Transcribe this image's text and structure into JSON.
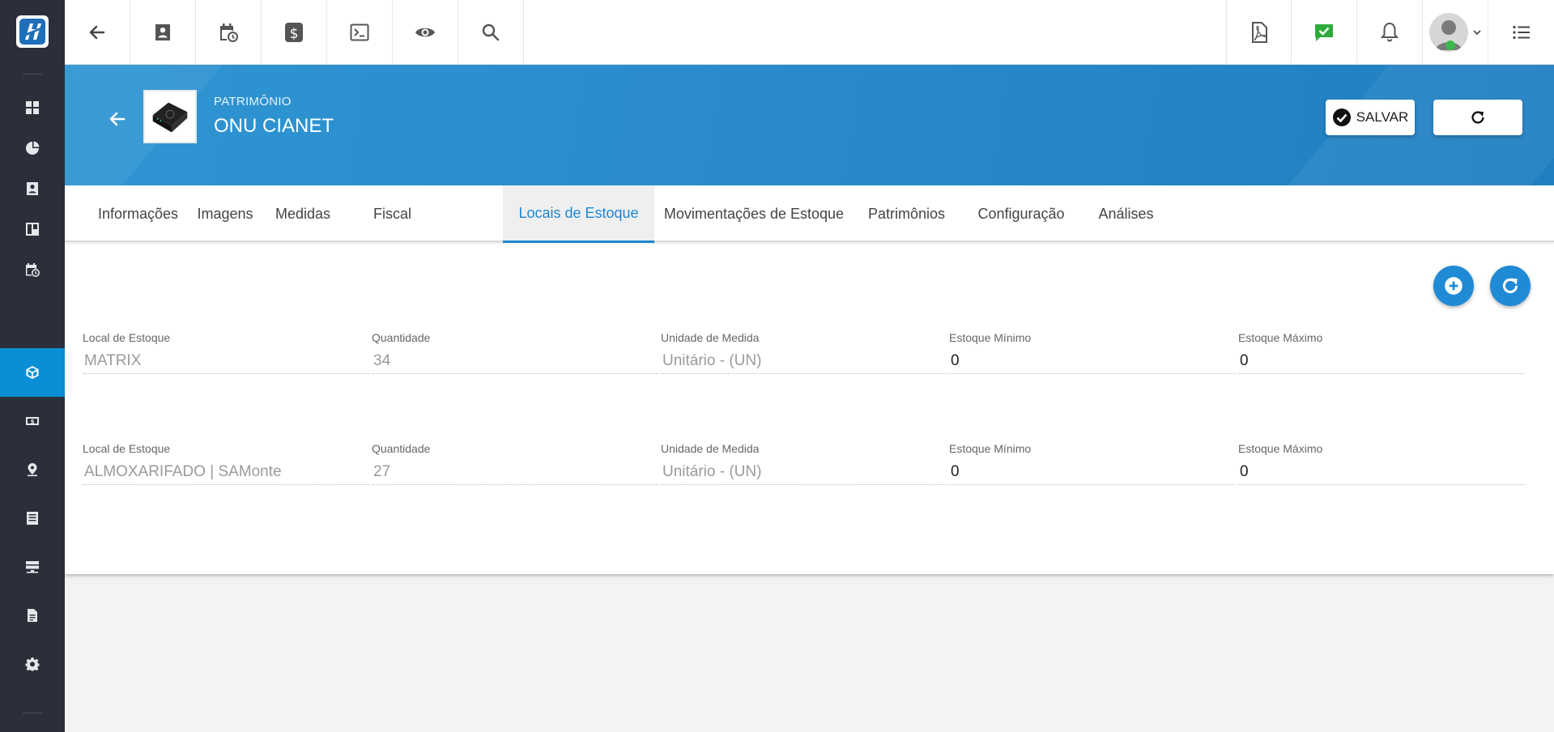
{
  "header": {
    "breadcrumb": "PATRIMÔNIO",
    "title": "ONU CIANET",
    "save_label": "SALVAR"
  },
  "tabs": [
    {
      "label": "Informações"
    },
    {
      "label": "Imagens"
    },
    {
      "label": "Medidas"
    },
    {
      "label": "Fiscal"
    },
    {
      "label": "Locais de Estoque",
      "active": true
    },
    {
      "label": "Movimentações de Estoque"
    },
    {
      "label": "Patrimônios"
    },
    {
      "label": "Configuração"
    },
    {
      "label": "Análises"
    }
  ],
  "stock_locations": {
    "labels": {
      "location": "Local de Estoque",
      "quantity": "Quantidade",
      "unit": "Unidade de Medida",
      "min": "Estoque Mínimo",
      "max": "Estoque Máximo"
    },
    "rows": [
      {
        "location": "MATRIX",
        "quantity": "34",
        "unit": "Unitário - (UN)",
        "min": "0",
        "max": "0"
      },
      {
        "location": "ALMOXARIFADO | SAMonte",
        "quantity": "27",
        "unit": "Unitário - (UN)",
        "min": "0",
        "max": "0"
      }
    ]
  },
  "colors": {
    "accent": "#1f86cf",
    "sidebar": "#2b2f3a",
    "sidebar_active": "#0a8fd6",
    "banner": "#2a8ccd",
    "chat_green": "#2eaa3c"
  }
}
